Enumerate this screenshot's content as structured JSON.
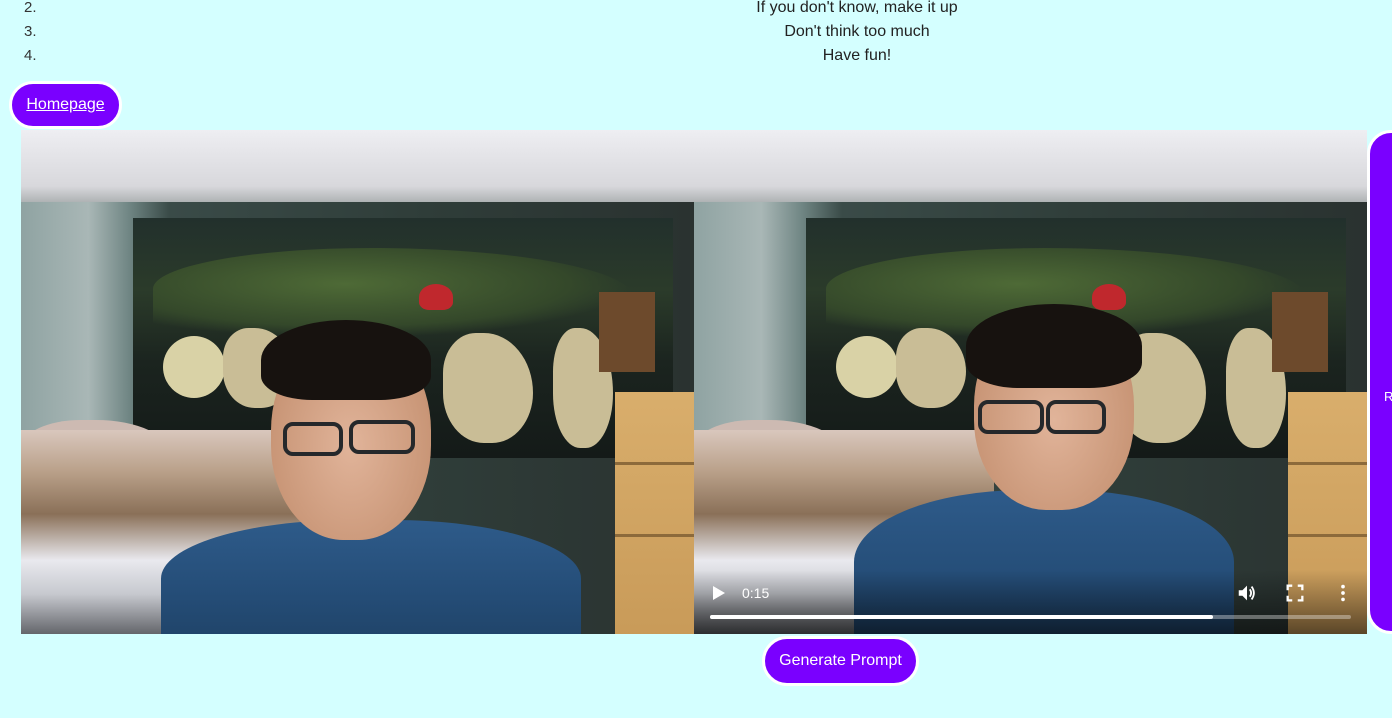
{
  "rules": [
    {
      "number": "2.",
      "text": "If you don't know, make it up"
    },
    {
      "number": "3.",
      "text": "Don't think too much"
    },
    {
      "number": "4.",
      "text": "Have fun!"
    }
  ],
  "nav": {
    "homepage_label": "Homepage"
  },
  "videos": {
    "left": {
      "kind": "live-camera"
    },
    "right": {
      "kind": "recorded-playback",
      "time": "0:15",
      "progress": 0.785,
      "controls": [
        "play-icon",
        "volume-icon",
        "fullscreen-icon",
        "more-vert-icon"
      ]
    }
  },
  "side_panel": {
    "label": "R"
  },
  "actions": {
    "generate_label": "Generate Prompt"
  },
  "colors": {
    "background": "#d4ffff",
    "accent": "#7a00ff",
    "button_text": "#ffffff"
  }
}
